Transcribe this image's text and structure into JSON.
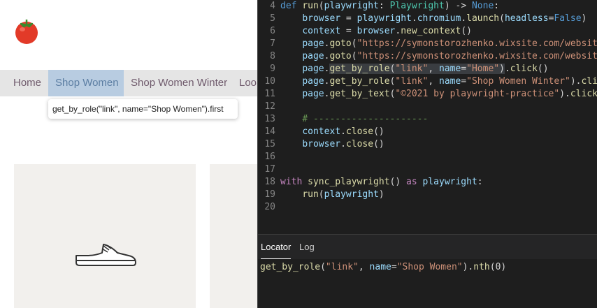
{
  "website": {
    "logo_icon": "tomato-icon",
    "nav": [
      {
        "label": "Home"
      },
      {
        "label": "Shop Women"
      },
      {
        "label": "Shop Women Winter"
      },
      {
        "label": "Loo"
      }
    ],
    "tooltip": "get_by_role(\"link\", name=\"Shop Women\").first",
    "product_icon": "shoe-icon"
  },
  "editor": {
    "line_numbers": [
      "4",
      "5",
      "6",
      "7",
      "8",
      "9",
      "10",
      "11",
      "12",
      "13",
      "14",
      "15",
      "16",
      "17",
      "18",
      "19",
      "20"
    ]
  },
  "tabs": [
    {
      "label": "Locator"
    },
    {
      "label": "Log"
    }
  ],
  "locator_value": "get_by_role(\"link\", name=\"Shop Women\").nth(0)",
  "colors": {
    "editor_bg": "#1e1e1e",
    "nav_bg": "#e5e5e5",
    "nav_active_bg": "#b8cce1",
    "keyword": "#c586c0",
    "string": "#ce9178",
    "function": "#dcdcaa",
    "variable": "#9cdcfe"
  }
}
